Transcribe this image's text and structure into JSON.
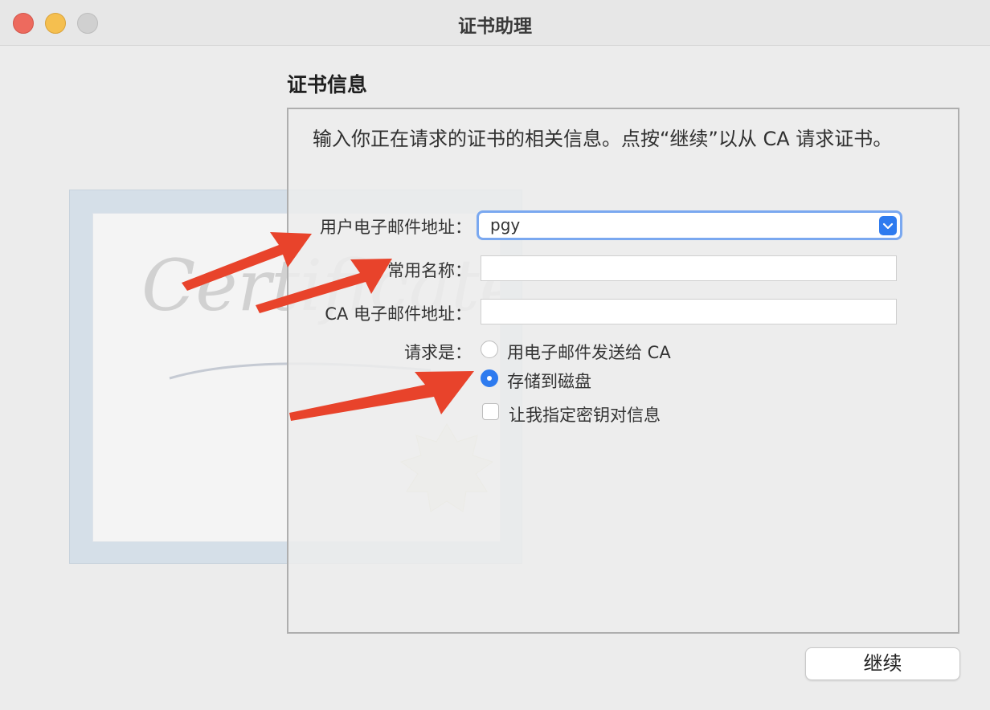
{
  "window": {
    "title": "证书助理"
  },
  "section": {
    "title": "证书信息",
    "description": "输入你正在请求的证书的相关信息。点按“继续”以从 CA 请求证书。"
  },
  "form": {
    "user_email_label": "用户电子邮件地址：",
    "user_email_value": "pgy",
    "common_name_label": "常用名称：",
    "common_name_value": "",
    "ca_email_label": "CA 电子邮件地址：",
    "ca_email_value": "",
    "request_label": "请求是：",
    "option_email_ca": "用电子邮件发送给 CA",
    "option_save_disk": "存储到磁盘",
    "option_selected": "存储到磁盘",
    "checkbox_key_info": "让我指定密钥对信息",
    "checkbox_checked": false
  },
  "footer": {
    "continue_label": "继续"
  },
  "background": {
    "watermark_text": "Certificate"
  },
  "colors": {
    "accent": "#2e7bef",
    "annotation_arrow": "#e8432b",
    "close": "#ed6a5e",
    "minimize": "#f5bf4f",
    "zoom": "#d0d0d0"
  },
  "icons": {
    "popup": "chevron-up-down-icon",
    "annotation": "red-arrow-icon"
  }
}
